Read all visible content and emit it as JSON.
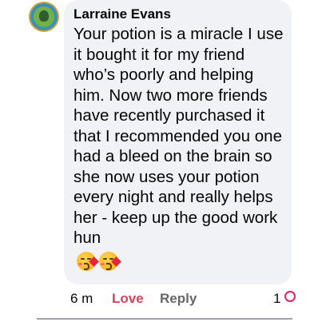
{
  "comment": {
    "author": "Larraine Evans",
    "text": "Your potion is a miracle I use it bought it for my friend who’s poorly and helping him. Now two more friends have recently purchased it that I recommended you one had a bleed on the brain so she now uses your potion every night and really helps her - keep up the good work hun",
    "emojis": [
      "face-blowing-a-kiss-icon",
      "face-blowing-a-kiss-icon"
    ]
  },
  "actions": {
    "time": "6 m",
    "love_label": "Love",
    "reply_label": "Reply",
    "reaction_count": "1",
    "reaction_icon": "love-reaction-icon"
  },
  "colors": {
    "bubble": "#f0f2f5",
    "love": "#d7425b",
    "muted": "#65676b",
    "reaction": "#e0245e"
  }
}
